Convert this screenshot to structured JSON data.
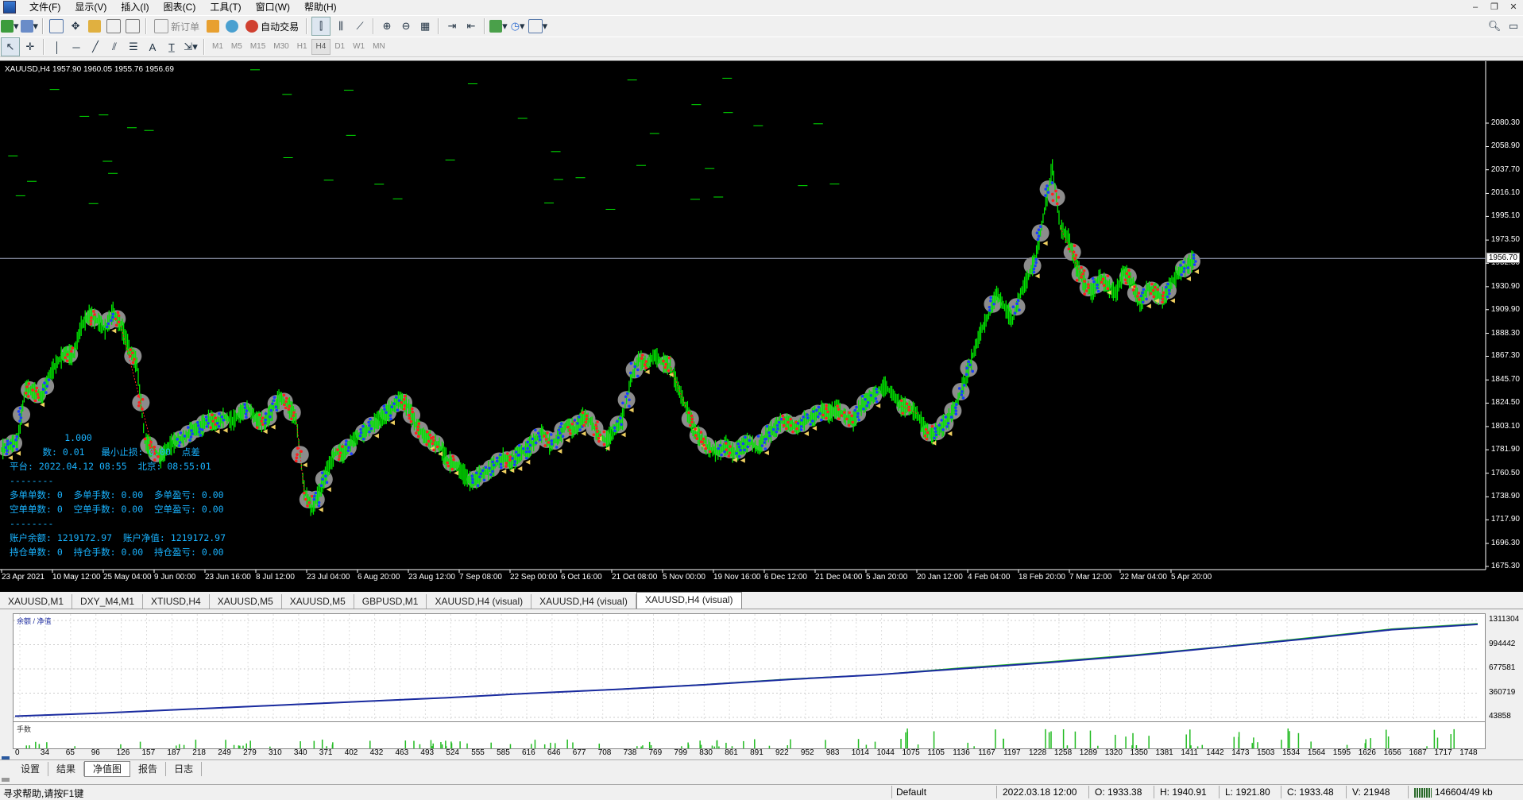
{
  "menu": [
    "文件(F)",
    "显示(V)",
    "插入(I)",
    "图表(C)",
    "工具(T)",
    "窗口(W)",
    "帮助(H)"
  ],
  "toolbar": {
    "new_order": "新订单",
    "auto_trade": "自动交易"
  },
  "timeframes": [
    "M1",
    "M5",
    "M15",
    "M30",
    "H1",
    "H4",
    "D1",
    "W1",
    "MN"
  ],
  "active_timeframe": "H4",
  "chart": {
    "title": "XAUUSD,H4  1957.90 1960.05 1955.76 1956.69",
    "current_price": "1956.70",
    "colors": {
      "background": "#000000",
      "candles": "#00e600",
      "buy": "#1a3cff",
      "sell": "#ff2020",
      "halo": "#8c8c8c",
      "marker": "#f0d060",
      "info_text": "#19b3ff"
    },
    "info_lines": [
      "          1.000",
      "      数: 0.01   最小止损: 0.00  点差",
      "平台: 2022.04.12 08:55  北京: 08:55:01",
      "--------",
      "多单单数: 0  多单手数: 0.00  多单盈亏: 0.00",
      "空单单数: 0  空单手数: 0.00  空单盈亏: 0.00",
      "--------",
      "账户余额: 1219172.97  账户净值: 1219172.97",
      "持仓单数: 0  持仓手数: 0.00  持仓盈亏: 0.00"
    ]
  },
  "chart_data": [
    {
      "type": "line",
      "title": "XAUUSD,H4",
      "y_ticks": [
        "2080.30",
        "2058.90",
        "2037.70",
        "2016.10",
        "1995.10",
        "1973.50",
        "1952.30",
        "1930.90",
        "1909.90",
        "1888.30",
        "1867.30",
        "1845.70",
        "1824.50",
        "1803.10",
        "1781.90",
        "1760.50",
        "1738.90",
        "1717.90",
        "1696.30",
        "1675.30"
      ],
      "ylim": [
        1675.3,
        2080.3
      ],
      "x_ticks": [
        "23 Apr 2021",
        "10 May 12:00",
        "25 May 04:00",
        "9 Jun 00:00",
        "23 Jun 16:00",
        "8 Jul 12:00",
        "23 Jul 04:00",
        "6 Aug 20:00",
        "23 Aug 12:00",
        "7 Sep 08:00",
        "22 Sep 00:00",
        "6 Oct 16:00",
        "21 Oct 08:00",
        "5 Nov 00:00",
        "19 Nov 16:00",
        "6 Dec 12:00",
        "21 Dec 04:00",
        "5 Jan 20:00",
        "20 Jan 12:00",
        "4 Feb 04:00",
        "18 Feb 20:00",
        "7 Mar 12:00",
        "22 Mar 04:00",
        "5 Apr 20:00"
      ],
      "series": [
        {
          "values": [
            1782,
            1786,
            1790,
            1838,
            1835,
            1830,
            1850,
            1862,
            1870,
            1868,
            1895,
            1905,
            1900,
            1892,
            1908,
            1895,
            1875,
            1860,
            1790,
            1782,
            1775,
            1785,
            1790,
            1793,
            1800,
            1802,
            1810,
            1806,
            1812,
            1808,
            1815,
            1820,
            1810,
            1806,
            1818,
            1830,
            1822,
            1810,
            1745,
            1728,
            1745,
            1765,
            1780,
            1778,
            1790,
            1795,
            1800,
            1808,
            1812,
            1820,
            1828,
            1822,
            1805,
            1795,
            1790,
            1785,
            1772,
            1768,
            1760,
            1752,
            1758,
            1762,
            1768,
            1775,
            1770,
            1778,
            1782,
            1790,
            1798,
            1785,
            1795,
            1805,
            1800,
            1812,
            1808,
            1795,
            1790,
            1800,
            1810,
            1845,
            1865,
            1860,
            1868,
            1862,
            1858,
            1838,
            1820,
            1800,
            1790,
            1782,
            1780,
            1786,
            1778,
            1785,
            1790,
            1782,
            1795,
            1800,
            1808,
            1806,
            1802,
            1810,
            1812,
            1818,
            1815,
            1820,
            1812,
            1808,
            1822,
            1828,
            1835,
            1840,
            1832,
            1822,
            1820,
            1815,
            1800,
            1795,
            1802,
            1810,
            1825,
            1845,
            1868,
            1890,
            1905,
            1925,
            1912,
            1900,
            1925,
            1940,
            1960,
            2000,
            2040,
            1985,
            1975,
            1950,
            1935,
            1925,
            1940,
            1930,
            1925,
            1945,
            1935,
            1915,
            1930,
            1925,
            1920,
            1935,
            1945,
            1950,
            1958
          ]
        }
      ]
    },
    {
      "type": "line",
      "title": "余额 / 净值",
      "y_ticks": [
        "1311304",
        "994442",
        "677581",
        "360719",
        "43858"
      ],
      "ylim": [
        43858,
        1311304
      ],
      "x_ticks": [
        "0",
        "34",
        "65",
        "96",
        "126",
        "157",
        "187",
        "218",
        "249",
        "279",
        "310",
        "340",
        "371",
        "402",
        "432",
        "463",
        "493",
        "524",
        "555",
        "585",
        "616",
        "646",
        "677",
        "708",
        "738",
        "769",
        "799",
        "830",
        "861",
        "891",
        "922",
        "952",
        "983",
        "1014",
        "1044",
        "1075",
        "1105",
        "1136",
        "1167",
        "1197",
        "1228",
        "1258",
        "1289",
        "1320",
        "1350",
        "1381",
        "1411",
        "1442",
        "1473",
        "1503",
        "1534",
        "1564",
        "1595",
        "1626",
        "1656",
        "1687",
        "1717",
        "1748"
      ],
      "series": [
        {
          "name": "余额",
          "values": [
            60000,
            100000,
            150000,
            200000,
            250000,
            300000,
            360000,
            410000,
            470000,
            540000,
            600000,
            680000,
            760000,
            850000,
            960000,
            1070000,
            1190000,
            1260000
          ]
        },
        {
          "name": "净值",
          "values": [
            60000,
            100000,
            150000,
            200000,
            250000,
            300000,
            360000,
            412000,
            472000,
            545000,
            600000,
            690000,
            770000,
            860000,
            965000,
            1080000,
            1200000,
            1270000
          ]
        }
      ]
    }
  ],
  "chart_tabs": [
    "XAUUSD,M1",
    "DXY_M4,M1",
    "XTIUSD,H4",
    "XAUUSD,M5",
    "XAUUSD,M5",
    "GBPUSD,M1",
    "XAUUSD,H4 (visual)",
    "XAUUSD,H4 (visual)",
    "XAUUSD,H4 (visual)"
  ],
  "equity": {
    "label": "余额 / 净值",
    "volume_label": "手数"
  },
  "bottom_tabs": [
    "设置",
    "结果",
    "净值图",
    "报告",
    "日志"
  ],
  "status": {
    "help": "寻求帮助,请按F1键",
    "profile": "Default",
    "time": "2022.03.18 12:00",
    "open": "O: 1933.38",
    "high": "H: 1940.91",
    "low": "L: 1921.80",
    "close": "C: 1933.48",
    "volume": "V: 21948",
    "traffic": "146604/49 kb"
  }
}
